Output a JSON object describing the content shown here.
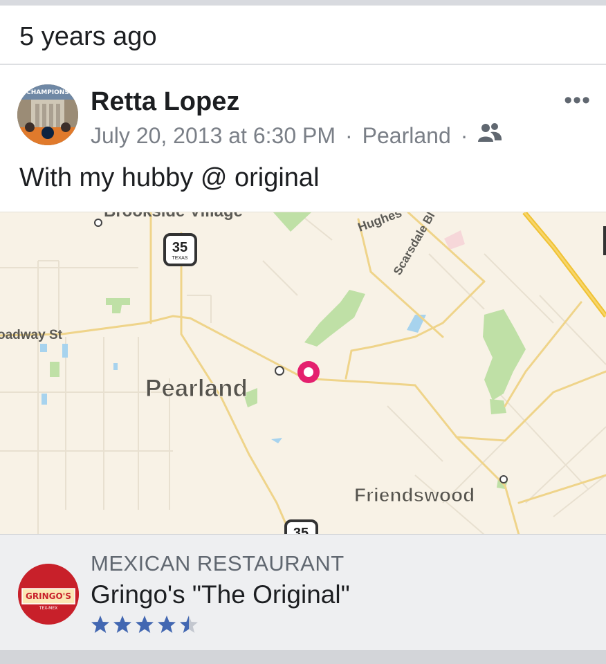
{
  "memory": {
    "title": "5 years ago"
  },
  "post": {
    "author": "Retta Lopez",
    "avatar_icon": "profile-photo",
    "date": "July 20, 2013 at 6:30 PM",
    "location": "Pearland",
    "privacy_icon": "friends-icon",
    "more_icon": "more-options-icon",
    "text": "With my hubby @ original"
  },
  "map": {
    "labels": [
      "Brookside Village",
      "Hughes",
      "Scarsdale Bl",
      "oadway St",
      "Pearland",
      "Friendswood"
    ],
    "highway_shield": "35",
    "highway_state": "TEXAS",
    "highway_shield_bottom": "35",
    "pin_color": "#e4206e"
  },
  "place": {
    "category": "MEXICAN RESTAURANT",
    "name": "Gringo's \"The Original\"",
    "logo_text": "GRINGO'S",
    "logo_sub": "TEX-MEX",
    "rating": 4.5,
    "star_color": "#4267b2"
  }
}
